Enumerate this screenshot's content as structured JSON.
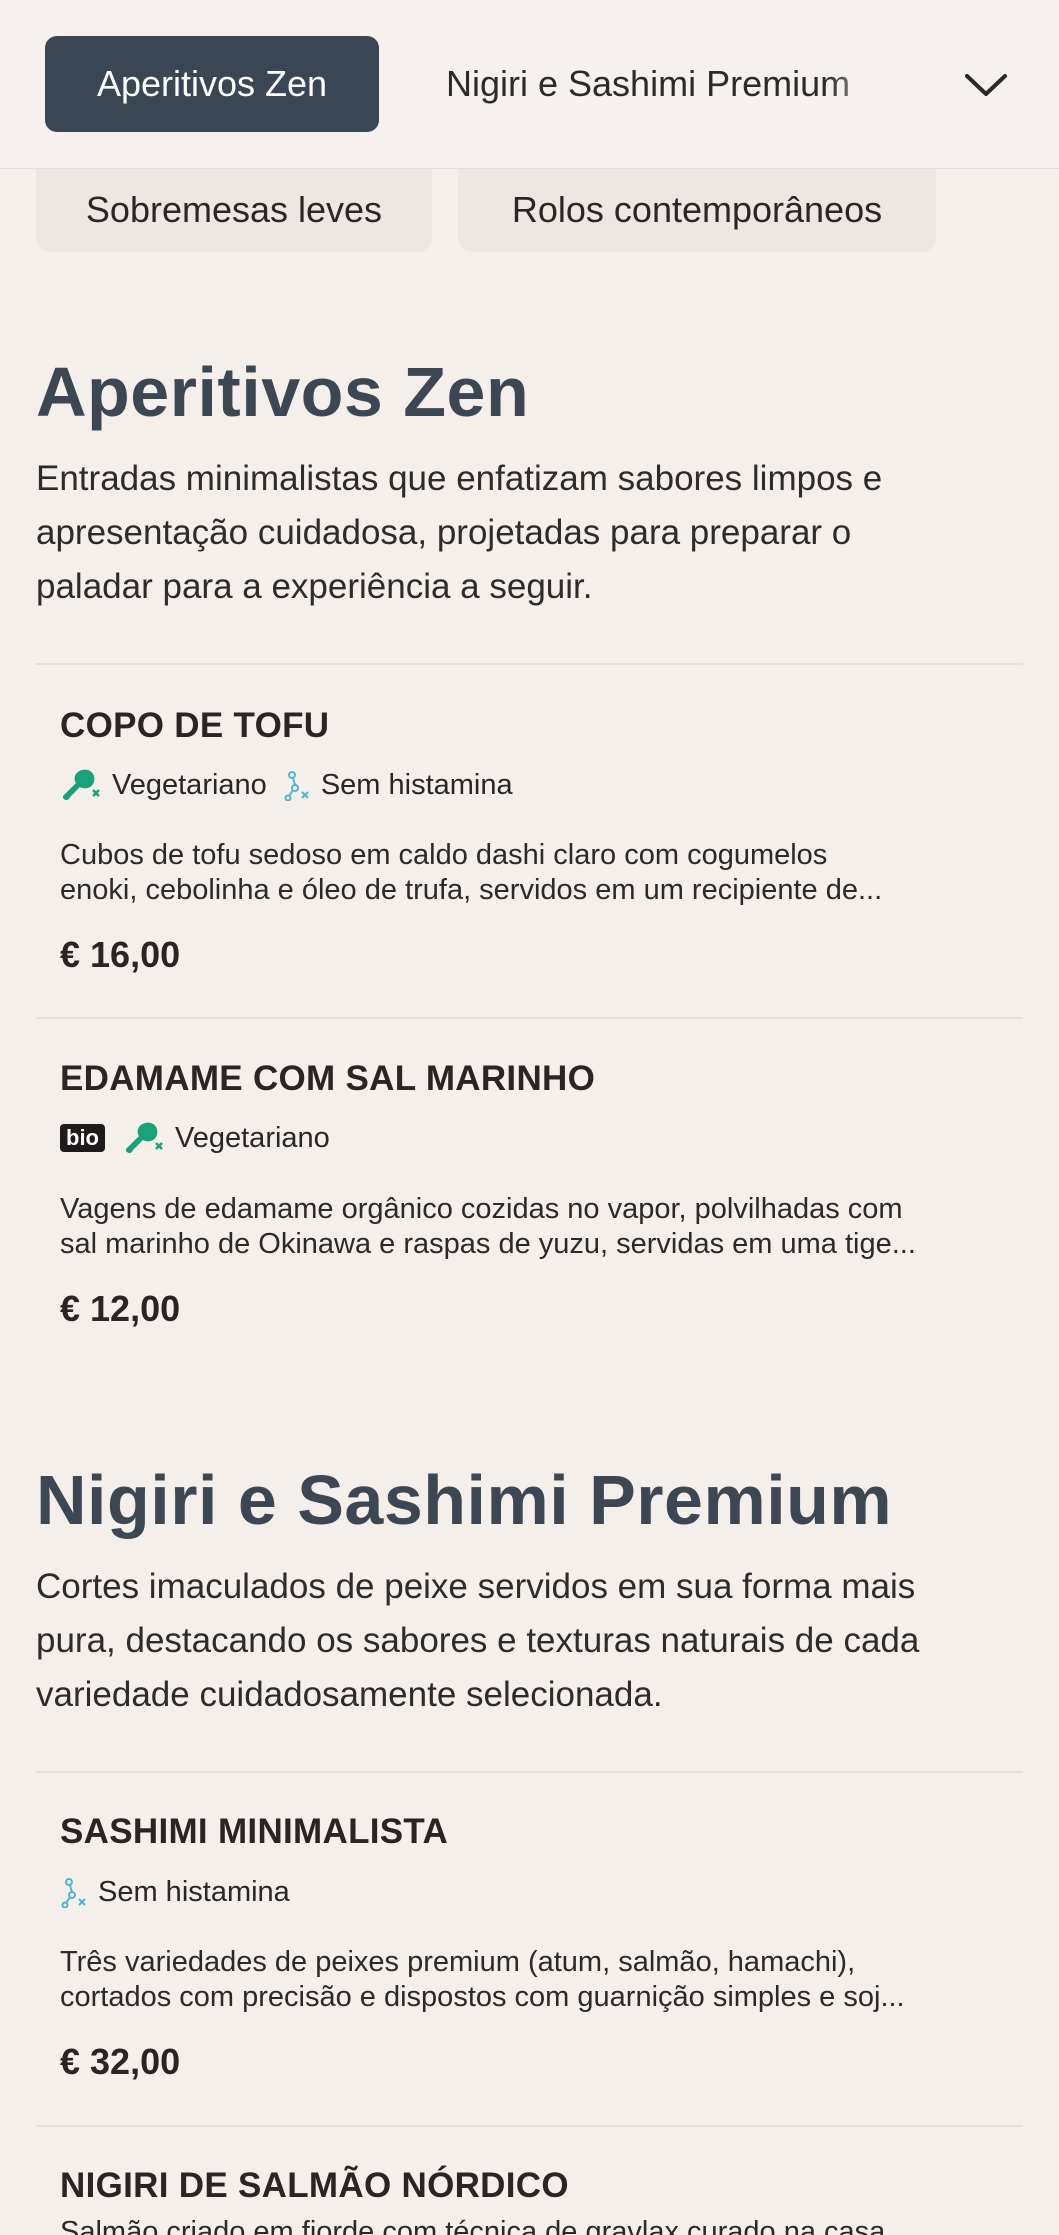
{
  "nav": {
    "active_tab": "Aperitivos Zen",
    "next_tab": "Nigiri e Sashimi Premium",
    "chips": [
      "Sobremesas leves",
      "Rolos contemporâneos"
    ]
  },
  "sections": [
    {
      "title": "Aperitivos Zen",
      "desc_lines": [
        "Entradas minimalistas que enfatizam sabores limpos e",
        "apresentação cuidadosa, projetadas para preparar o",
        "paladar para a experiência a seguir."
      ],
      "items": [
        {
          "name": "COPO DE TOFU",
          "tags": {
            "vegetarian": "Vegetariano",
            "histamine": "Sem histamina"
          },
          "desc_lines": [
            "Cubos de tofu sedoso em caldo dashi claro com cogumelos",
            "enoki, cebolinha e óleo de trufa, servidos em um recipiente de..."
          ],
          "price": "€ 16,00"
        },
        {
          "name": "EDAMAME COM SAL MARINHO",
          "tags": {
            "bio": "bio",
            "vegetarian": "Vegetariano"
          },
          "desc_lines": [
            "Vagens de edamame orgânico cozidas no vapor, polvilhadas com",
            "sal marinho de Okinawa e raspas de yuzu, servidas em uma tige..."
          ],
          "price": "€ 12,00"
        }
      ]
    },
    {
      "title": "Nigiri e Sashimi Premium",
      "desc_lines": [
        "Cortes imaculados de peixe servidos em sua forma mais",
        "pura, destacando os sabores e texturas naturais de cada",
        "variedade cuidadosamente selecionada."
      ],
      "items": [
        {
          "name": "SASHIMI MINIMALISTA",
          "tags": {
            "histamine": "Sem histamina"
          },
          "desc_lines": [
            "Três variedades de peixes premium (atum, salmão, hamachi),",
            "cortados com precisão e dispostos com guarnição simples e soj..."
          ],
          "price": "€ 32,00"
        },
        {
          "name": "NIGIRI DE SALMÃO NÓRDICO",
          "desc_lines": [
            "Salmão criado em fiorde com técnica de gravlax curado na casa"
          ]
        }
      ]
    }
  ],
  "colors": {
    "background": "#f5efec",
    "active_tab": "#3b4654",
    "section_title": "#3d4753",
    "vegetarian_icon": "#1aa37a",
    "histamine_icon": "#4fb6d0"
  },
  "icons": {
    "vegetarian": "leaf-drumstick-icon",
    "histamine": "histamine-free-icon",
    "chevron": "chevron-down-icon"
  }
}
